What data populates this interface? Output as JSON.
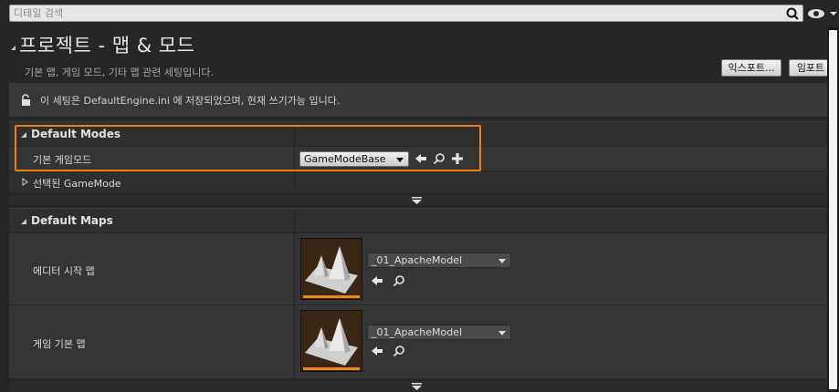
{
  "search": {
    "placeholder": "디테일 검색",
    "value": ""
  },
  "header": {
    "title": "프로젝트 - 맵 & 모드",
    "subtitle": "기본 맵, 게임 모드, 기타 맵 관련 세팅입니다.",
    "export_label": "익스포트...",
    "import_label": "임포트"
  },
  "notice": {
    "text": "이 세팅은 DefaultEngine.ini 에 저장되었으며, 현재 쓰기가능 입니다."
  },
  "sections": {
    "default_modes": {
      "title": "Default Modes",
      "rows": {
        "game_mode_label": "기본 게임모드",
        "game_mode_value": "GameModeBase",
        "selected_label": "선택된 GameMode"
      }
    },
    "default_maps": {
      "title": "Default Maps",
      "rows": {
        "editor_start_label": "에디터 시작 맵",
        "editor_start_value": "_01_ApacheModel",
        "game_default_label": "게임 기본 맵",
        "game_default_value": "_01_ApacheModel"
      }
    }
  },
  "colors": {
    "highlight": "#ef7f1a",
    "accent_bar": "#ef8a1a"
  },
  "icons": [
    "search-icon",
    "eye-icon",
    "lock-icon",
    "arrow-left-icon",
    "magnify-icon",
    "plus-icon",
    "chevron-down-icon"
  ]
}
